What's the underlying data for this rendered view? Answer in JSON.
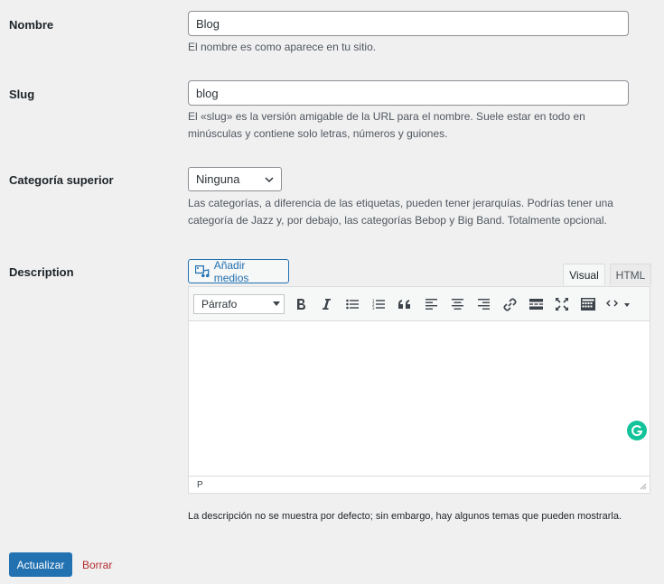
{
  "form": {
    "name": {
      "label": "Nombre",
      "value": "Blog",
      "help": "El nombre es como aparece en tu sitio."
    },
    "slug": {
      "label": "Slug",
      "value": "blog",
      "help_line1": "El «slug» es la versión amigable de la URL para el nombre. Suele estar en todo en",
      "help_line2": "minúsculas y contiene solo letras, números y guiones."
    },
    "parent": {
      "label": "Categoría superior",
      "selected": "Ninguna",
      "help_line1": "Las categorías, a diferencia de las etiquetas, pueden tener jerarquías. Podrías tener una",
      "help_line2": "categoría de Jazz y, por debajo, las categorías Bebop y Big Band. Totalmente opcional."
    },
    "description": {
      "label": "Description",
      "add_media_label": "Añadir medios",
      "tab_visual": "Visual",
      "tab_html": "HTML",
      "format_selected": "Párrafo",
      "status_path": "P",
      "help": "La descripción no se muestra por defecto; sin embargo, hay algunos temas que pueden mostrarla."
    }
  },
  "actions": {
    "update_label": "Actualizar",
    "delete_label": "Borrar"
  },
  "toolbar_icons": [
    "bold-icon",
    "italic-icon",
    "bulleted-list-icon",
    "numbered-list-icon",
    "blockquote-icon",
    "align-left-icon",
    "align-center-icon",
    "align-right-icon",
    "link-icon",
    "read-more-icon",
    "fullscreen-icon",
    "toolbar-toggle-icon",
    "code-icon"
  ],
  "colors": {
    "primary": "#2271b1",
    "danger": "#b32d2e",
    "background": "#f0f0f1"
  }
}
